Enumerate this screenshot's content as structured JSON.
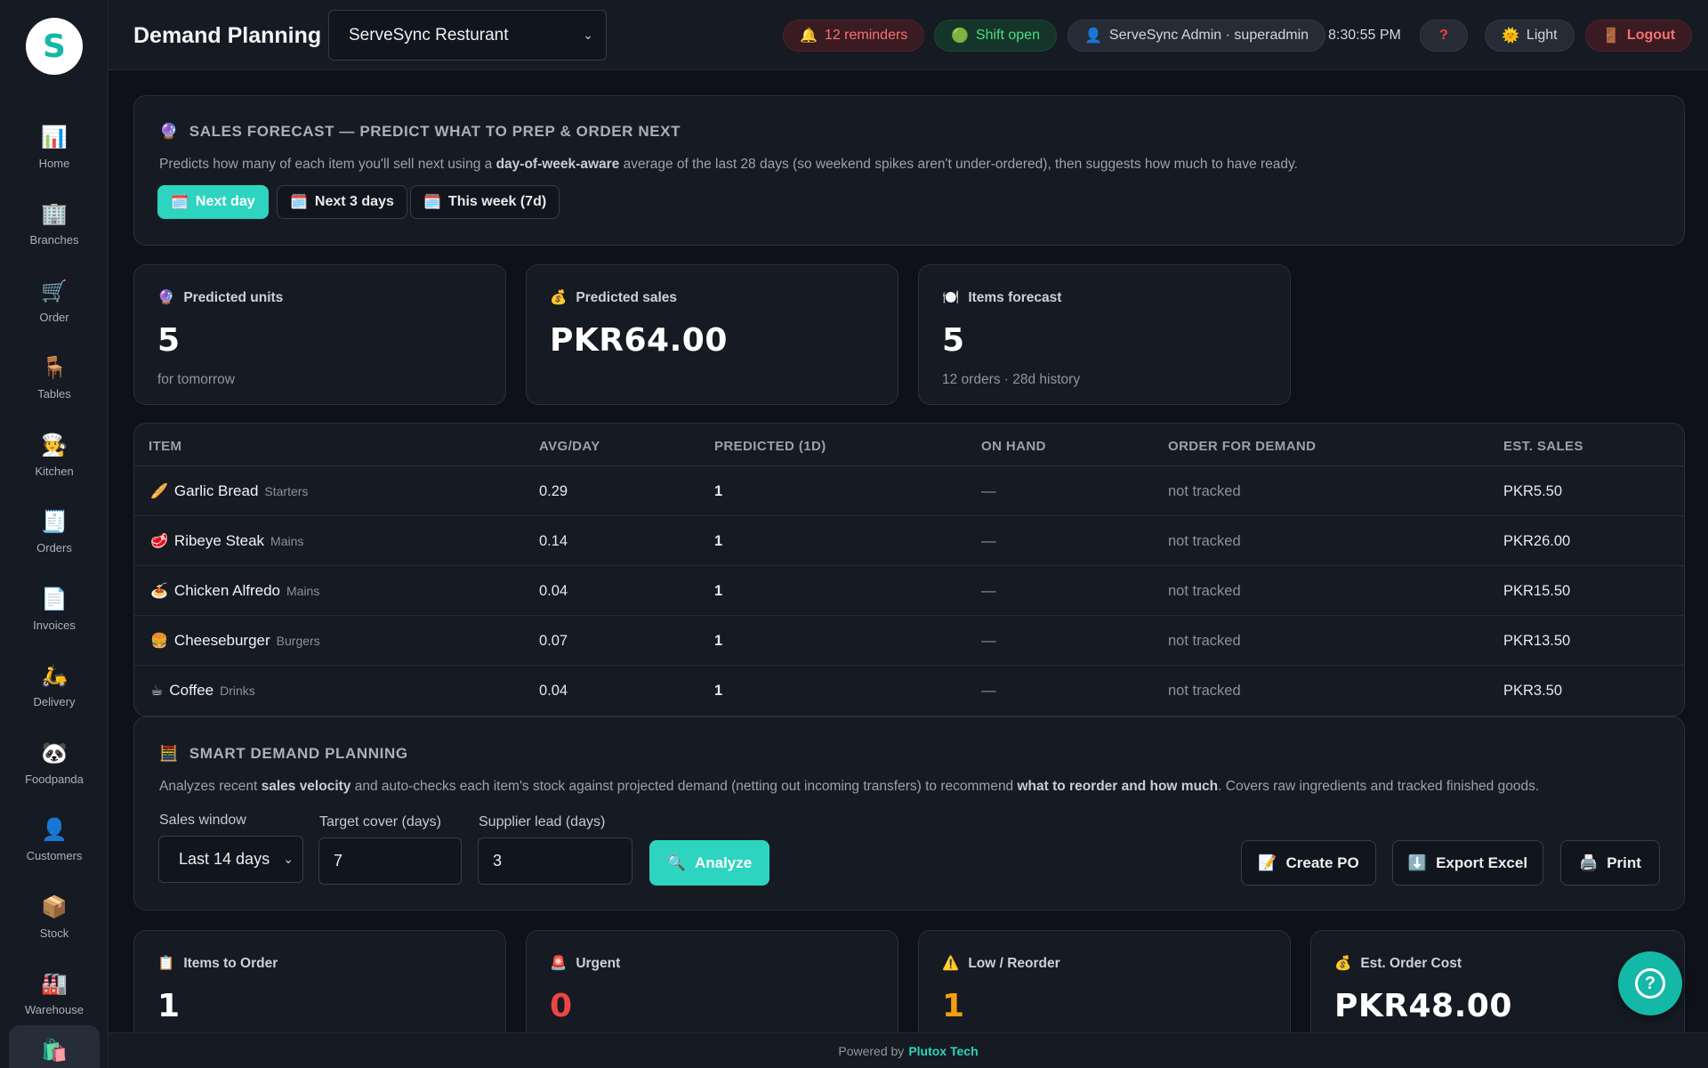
{
  "sidebar": {
    "logo_letter": "S",
    "items": [
      {
        "label": "Home",
        "icon": "📊"
      },
      {
        "label": "Branches",
        "icon": "🏢"
      },
      {
        "label": "Order",
        "icon": "🛒"
      },
      {
        "label": "Tables",
        "icon": "🪑"
      },
      {
        "label": "Kitchen",
        "icon": "🧑‍🍳"
      },
      {
        "label": "Orders",
        "icon": "🧾"
      },
      {
        "label": "Invoices",
        "icon": "📄"
      },
      {
        "label": "Delivery",
        "icon": "🛵"
      },
      {
        "label": "Foodpanda",
        "icon": "🐼"
      },
      {
        "label": "Customers",
        "icon": "👤"
      },
      {
        "label": "Stock",
        "icon": "📦"
      },
      {
        "label": "Warehouse",
        "icon": "🏭"
      }
    ],
    "active_icon": "🛍️"
  },
  "header": {
    "title": "Demand Planning",
    "branch": "ServeSync Resturant",
    "reminders": "12 reminders",
    "shift": "Shift open",
    "user": "ServeSync Admin · superadmin",
    "time": "8:30:55 PM",
    "help": "?",
    "theme": "Light",
    "logout": "Logout"
  },
  "forecast": {
    "icon": "🔮",
    "title": "Sales forecast — predict what to prep & order next",
    "desc_pre": "Predicts how many of each item you'll sell next using a ",
    "desc_bold": "day-of-week-aware",
    "desc_post": " average of the last 28 days (so weekend spikes aren't under-ordered), then suggests how much to have ready.",
    "chips": [
      "Next day",
      "Next 3 days",
      "This week (7d)"
    ],
    "active_chip": "Next day"
  },
  "kpis": [
    {
      "icon": "🔮",
      "label": "Predicted units",
      "value": "5",
      "sub": "for tomorrow"
    },
    {
      "icon": "💰",
      "label": "Predicted sales",
      "value": "PKR64.00",
      "sub": ""
    },
    {
      "icon": "🍽️",
      "label": "Items forecast",
      "value": "5",
      "sub": "12 orders · 28d history"
    }
  ],
  "table": {
    "headers": [
      "ITEM",
      "AVG/DAY",
      "PREDICTED (1D)",
      "ON HAND",
      "ORDER FOR DEMAND",
      "EST. SALES"
    ],
    "rows": [
      {
        "emoji": "🥖",
        "name": "Garlic Bread",
        "cat": "Starters",
        "avg": "0.29",
        "pred": "1",
        "onhand": "—",
        "order": "not tracked",
        "sales": "PKR5.50"
      },
      {
        "emoji": "🥩",
        "name": "Ribeye Steak",
        "cat": "Mains",
        "avg": "0.14",
        "pred": "1",
        "onhand": "—",
        "order": "not tracked",
        "sales": "PKR26.00"
      },
      {
        "emoji": "🍝",
        "name": "Chicken Alfredo",
        "cat": "Mains",
        "avg": "0.04",
        "pred": "1",
        "onhand": "—",
        "order": "not tracked",
        "sales": "PKR15.50"
      },
      {
        "emoji": "🍔",
        "name": "Cheeseburger",
        "cat": "Burgers",
        "avg": "0.07",
        "pred": "1",
        "onhand": "—",
        "order": "not tracked",
        "sales": "PKR13.50"
      },
      {
        "emoji": "☕",
        "name": "Coffee",
        "cat": "Drinks",
        "avg": "0.04",
        "pred": "1",
        "onhand": "—",
        "order": "not tracked",
        "sales": "PKR3.50"
      }
    ]
  },
  "smart": {
    "icon": "🧮",
    "title": "Smart demand planning",
    "d1": "Analyzes recent ",
    "d2": "sales velocity",
    "d3": " and auto-checks each item's stock against projected demand (netting out incoming transfers) to recommend ",
    "d4": "what to reorder and how much",
    "d5": ". Covers raw ingredients and tracked finished goods.",
    "window_label": "Sales window",
    "window_value": "Last 14 days",
    "cover_label": "Target cover (days)",
    "cover_value": "7",
    "lead_label": "Supplier lead (days)",
    "lead_value": "3",
    "analyze": "Analyze",
    "create_po": "Create PO",
    "export": "Export Excel",
    "print": "Print"
  },
  "stats": [
    {
      "icon": "📋",
      "label": "Items to Order",
      "value": "1",
      "color": "#ffffff"
    },
    {
      "icon": "🚨",
      "label": "Urgent",
      "value": "0",
      "color": "#ef4444"
    },
    {
      "icon": "⚠️",
      "label": "Low / Reorder",
      "value": "1",
      "color": "#f59e0b"
    },
    {
      "icon": "💰",
      "label": "Est. Order Cost",
      "value": "PKR48.00",
      "color": "#ffffff"
    }
  ],
  "footer": {
    "prefix": "Powered by",
    "brand": "Plutox Tech"
  }
}
